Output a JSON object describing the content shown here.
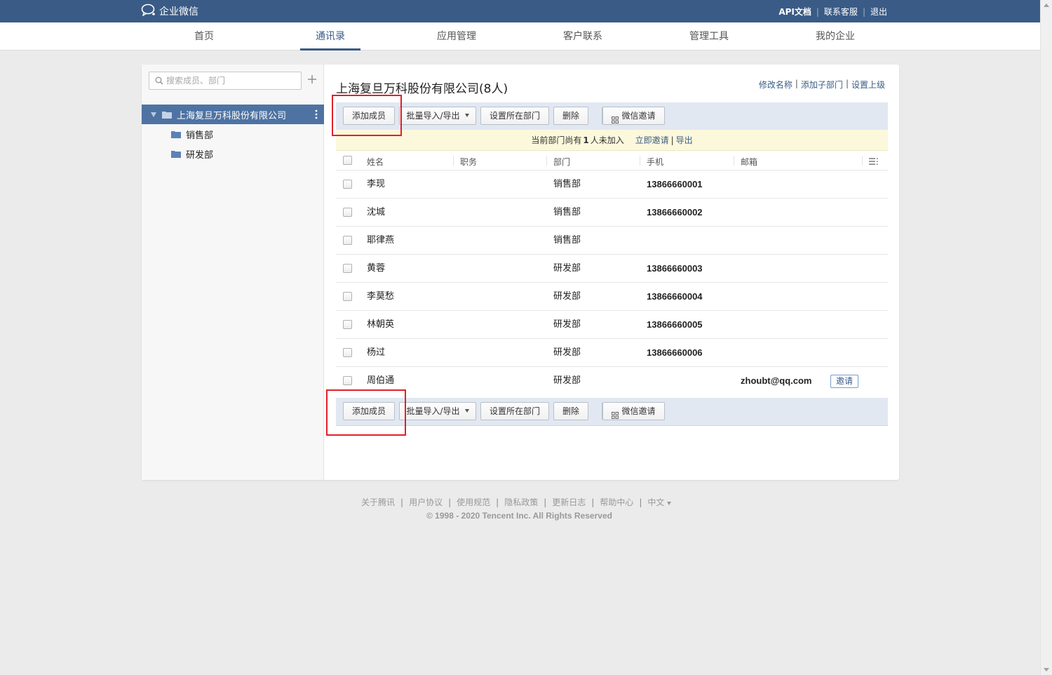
{
  "header": {
    "app_name": "企业微信",
    "links": {
      "api_docs": "API文档",
      "contact_support": "联系客服",
      "logout": "退出"
    }
  },
  "nav": {
    "items": [
      {
        "label": "首页",
        "active": false
      },
      {
        "label": "通讯录",
        "active": true
      },
      {
        "label": "应用管理",
        "active": false
      },
      {
        "label": "客户联系",
        "active": false
      },
      {
        "label": "管理工具",
        "active": false
      },
      {
        "label": "我的企业",
        "active": false
      }
    ]
  },
  "sidebar": {
    "search_placeholder": "搜索成员、部门",
    "root_department": "上海复旦万科股份有限公司",
    "departments": [
      "销售部",
      "研发部"
    ]
  },
  "main": {
    "company_name": "上海复旦万科股份有限公司",
    "member_count_text": "(8人)",
    "title_links": [
      "修改名称",
      "添加子部门",
      "设置上级"
    ],
    "toolbar": {
      "add_member": "添加成员",
      "batch_import_export": "批量导入/导出",
      "set_department": "设置所在部门",
      "delete": "删除",
      "wechat_invite": "微信邀请"
    },
    "notice": {
      "prefix": "当前部门尚有",
      "count": "1",
      "suffix": "人未加入",
      "invite_now": "立即邀请",
      "export": "导出"
    },
    "table": {
      "headers": {
        "name": "姓名",
        "position": "职务",
        "department": "部门",
        "phone": "手机",
        "email": "邮箱"
      },
      "rows": [
        {
          "name": "李现",
          "position": "",
          "department": "销售部",
          "phone": "13866660001",
          "email": ""
        },
        {
          "name": "沈城",
          "position": "",
          "department": "销售部",
          "phone": "13866660002",
          "email": ""
        },
        {
          "name": "耶律燕",
          "position": "",
          "department": "销售部",
          "phone": "",
          "email": ""
        },
        {
          "name": "黄蓉",
          "position": "",
          "department": "研发部",
          "phone": "13866660003",
          "email": ""
        },
        {
          "name": "李莫愁",
          "position": "",
          "department": "研发部",
          "phone": "13866660004",
          "email": ""
        },
        {
          "name": "林朝英",
          "position": "",
          "department": "研发部",
          "phone": "13866660005",
          "email": ""
        },
        {
          "name": "杨过",
          "position": "",
          "department": "研发部",
          "phone": "13866660006",
          "email": ""
        },
        {
          "name": "周伯通",
          "position": "",
          "department": "研发部",
          "phone": "",
          "email": "zhoubt@qq.com",
          "action": "邀请"
        }
      ]
    }
  },
  "footer": {
    "links": [
      "关于腾讯",
      "用户协议",
      "使用规范",
      "隐私政策",
      "更新日志",
      "帮助中心"
    ],
    "language": "中文",
    "copyright": "© 1998 - 2020 Tencent Inc. All Rights Reserved"
  },
  "colors": {
    "header_bg": "#3a5b86",
    "sidebar_selected_bg": "#4e73a3",
    "toolbar_bg": "#e1e8f2",
    "notice_bg": "#fcf8dc",
    "highlight_border": "#e2202a"
  }
}
